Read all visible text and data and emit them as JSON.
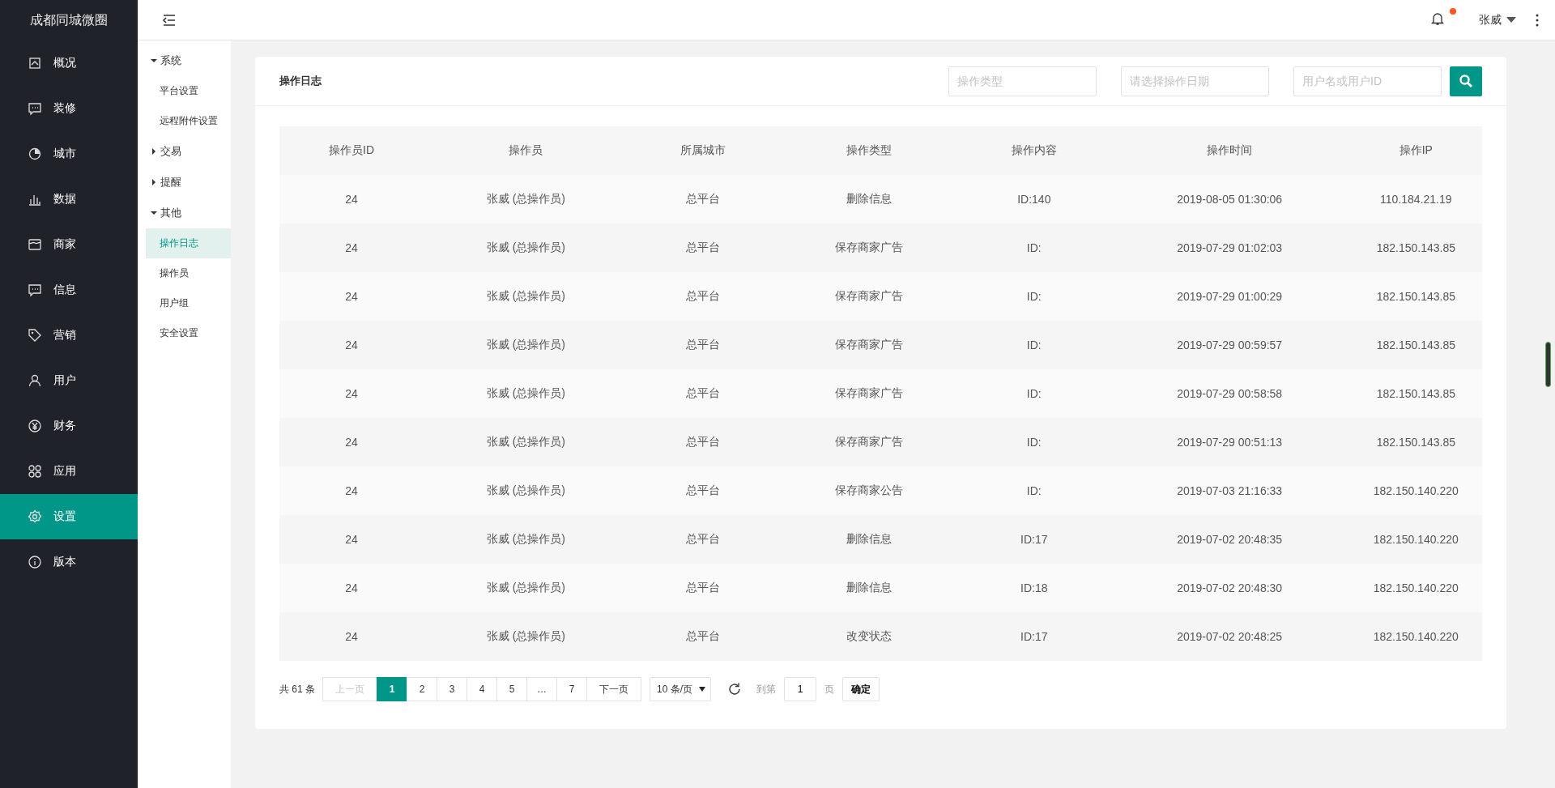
{
  "app_title": "成都同城微圈",
  "sidebar": {
    "items": [
      {
        "label": "概况",
        "selected": false
      },
      {
        "label": "装修",
        "selected": false
      },
      {
        "label": "城市",
        "selected": false
      },
      {
        "label": "数据",
        "selected": false
      },
      {
        "label": "商家",
        "selected": false
      },
      {
        "label": "信息",
        "selected": false
      },
      {
        "label": "营销",
        "selected": false
      },
      {
        "label": "用户",
        "selected": false
      },
      {
        "label": "财务",
        "selected": false
      },
      {
        "label": "应用",
        "selected": false
      },
      {
        "label": "设置",
        "selected": true
      },
      {
        "label": "版本",
        "selected": false
      }
    ]
  },
  "header": {
    "user": "张威",
    "has_unread": true
  },
  "submenu": [
    {
      "label": "系统",
      "expanded": true,
      "children": [
        {
          "label": "平台设置",
          "selected": false
        },
        {
          "label": "远程附件设置",
          "selected": false
        }
      ]
    },
    {
      "label": "交易",
      "expanded": false
    },
    {
      "label": "提醒",
      "expanded": false
    },
    {
      "label": "其他",
      "expanded": true,
      "children": [
        {
          "label": "操作日志",
          "selected": true
        },
        {
          "label": "操作员",
          "selected": false
        },
        {
          "label": "用户组",
          "selected": false
        },
        {
          "label": "安全设置",
          "selected": false
        }
      ]
    }
  ],
  "card": {
    "title": "操作日志",
    "filters": [
      {
        "placeholder": "操作类型"
      },
      {
        "placeholder": "请选择操作日期"
      },
      {
        "placeholder": "用户名或用户ID"
      }
    ]
  },
  "table": {
    "columns": [
      "操作员ID",
      "操作员",
      "所属城市",
      "操作类型",
      "操作内容",
      "操作时间",
      "操作IP"
    ],
    "rows": [
      [
        "24",
        "张威 (总操作员)",
        "总平台",
        "删除信息",
        "ID:140",
        "2019-08-05 01:30:06",
        "110.184.21.19"
      ],
      [
        "24",
        "张威 (总操作员)",
        "总平台",
        "保存商家广告",
        "ID:",
        "2019-07-29 01:02:03",
        "182.150.143.85"
      ],
      [
        "24",
        "张威 (总操作员)",
        "总平台",
        "保存商家广告",
        "ID:",
        "2019-07-29 01:00:29",
        "182.150.143.85"
      ],
      [
        "24",
        "张威 (总操作员)",
        "总平台",
        "保存商家广告",
        "ID:",
        "2019-07-29 00:59:57",
        "182.150.143.85"
      ],
      [
        "24",
        "张威 (总操作员)",
        "总平台",
        "保存商家广告",
        "ID:",
        "2019-07-29 00:58:58",
        "182.150.143.85"
      ],
      [
        "24",
        "张威 (总操作员)",
        "总平台",
        "保存商家广告",
        "ID:",
        "2019-07-29 00:51:13",
        "182.150.143.85"
      ],
      [
        "24",
        "张威 (总操作员)",
        "总平台",
        "保存商家公告",
        "ID:",
        "2019-07-03 21:16:33",
        "182.150.140.220"
      ],
      [
        "24",
        "张威 (总操作员)",
        "总平台",
        "删除信息",
        "ID:17",
        "2019-07-02 20:48:35",
        "182.150.140.220"
      ],
      [
        "24",
        "张威 (总操作员)",
        "总平台",
        "删除信息",
        "ID:18",
        "2019-07-02 20:48:30",
        "182.150.140.220"
      ],
      [
        "24",
        "张威 (总操作员)",
        "总平台",
        "改变状态",
        "ID:17",
        "2019-07-02 20:48:25",
        "182.150.140.220"
      ]
    ]
  },
  "pagination": {
    "total": "共 61 条",
    "prev": {
      "label": "上一页",
      "disabled": true
    },
    "pages": [
      {
        "label": "1",
        "selected": true
      },
      {
        "label": "2",
        "selected": false
      },
      {
        "label": "3",
        "selected": false
      },
      {
        "label": "4",
        "selected": false
      },
      {
        "label": "5",
        "selected": false
      },
      {
        "label": "…",
        "selected": false
      },
      {
        "label": "7",
        "selected": false
      }
    ],
    "next": {
      "label": "下一页",
      "disabled": false
    },
    "page_size": "10 条/页",
    "goto_label": "到第",
    "goto_value": "1",
    "page_unit": "页",
    "confirm": "确定"
  }
}
